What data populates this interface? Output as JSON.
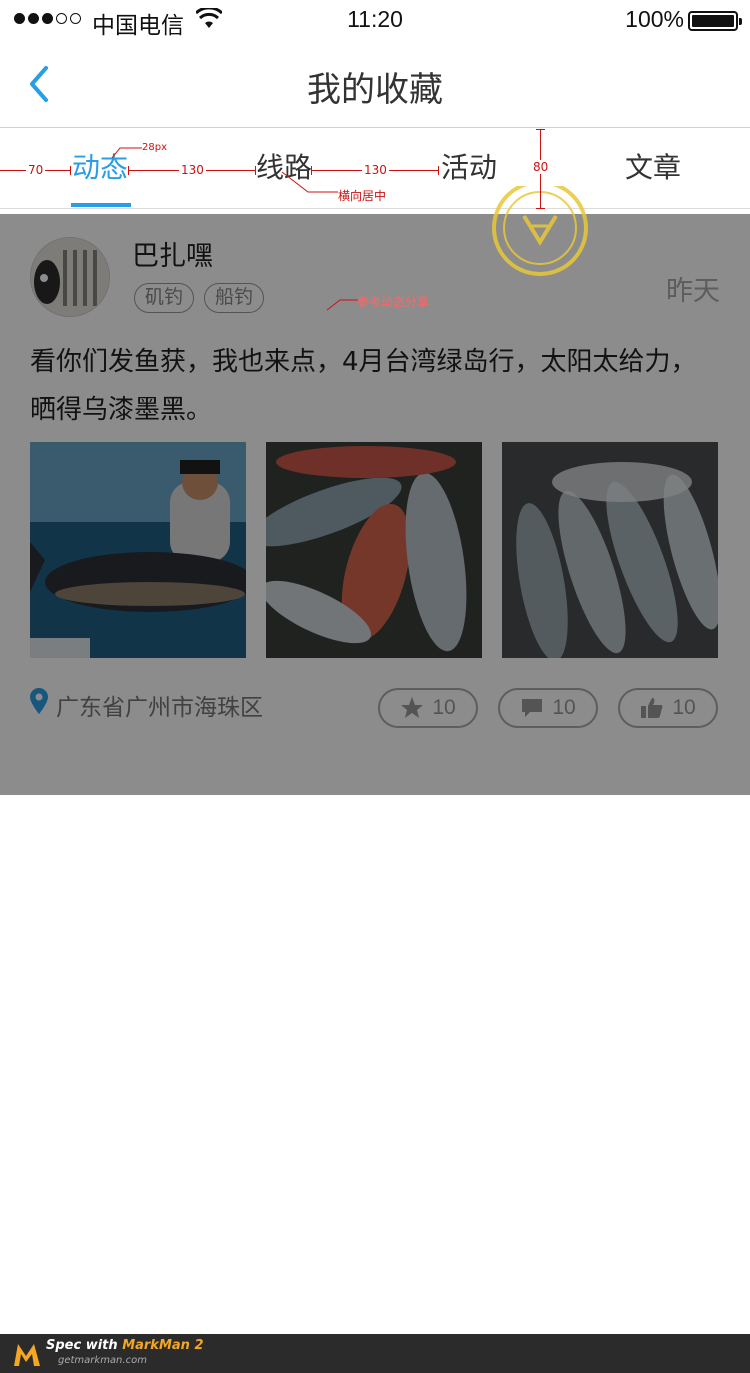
{
  "status_bar": {
    "carrier": "中国电信",
    "time": "11:20",
    "battery": "100%"
  },
  "nav": {
    "title": "我的收藏"
  },
  "tabs": [
    {
      "label": "动态",
      "active": true
    },
    {
      "label": "线路",
      "active": false
    },
    {
      "label": "活动",
      "active": false
    },
    {
      "label": "文章",
      "active": false
    }
  ],
  "post": {
    "username": "巴扎嘿",
    "tags": [
      "矶钓",
      "船钓"
    ],
    "time": "昨天",
    "text": "看你们发鱼获，我也来点，4月台湾绿岛行，太阳太给力，晒得乌漆墨黑。",
    "location": "广东省广州市海珠区",
    "actions": {
      "favorite_count": "10",
      "comment_count": "10",
      "like_count": "10"
    }
  },
  "annotations": {
    "font_size_note": "28px",
    "left_margin": "70",
    "gap1": "130",
    "gap2": "130",
    "tab_height": "80",
    "center_note": "横向居中",
    "ref_note": "参考动态分享"
  },
  "footer": {
    "brand_prefix": "Spec with ",
    "brand_name": "MarkMan 2",
    "url": "getmarkman.com"
  }
}
